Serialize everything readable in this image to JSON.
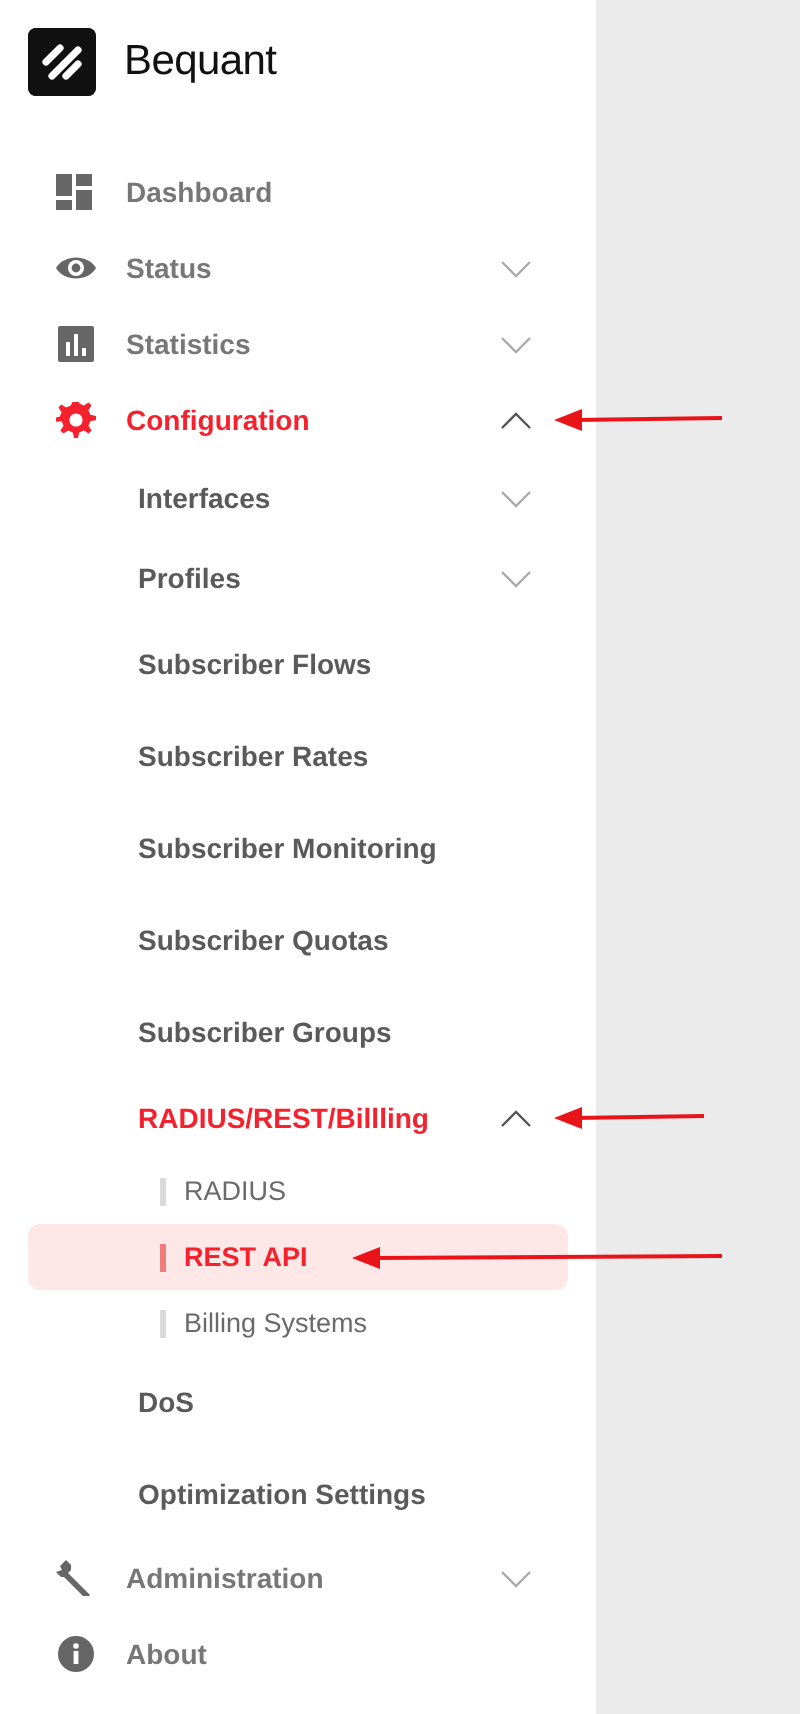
{
  "brand": {
    "name": "Bequant"
  },
  "nav": [
    {
      "label": "Dashboard",
      "selected": false,
      "arrow": false
    },
    {
      "label": "Status",
      "selected": false,
      "expanded": false,
      "arrow": false
    },
    {
      "label": "Statistics",
      "selected": false,
      "expanded": false,
      "arrow": false
    },
    {
      "label": "Configuration",
      "selected": false,
      "expanded": true,
      "arrow": true,
      "children": [
        {
          "label": "Interfaces",
          "selected": false,
          "expanded": false,
          "arrow": false
        },
        {
          "label": "Profiles",
          "selected": false,
          "expanded": false,
          "arrow": false
        },
        {
          "label": "Subscriber Flows",
          "selected": false,
          "arrow": false
        },
        {
          "label": "Subscriber Rates",
          "selected": false,
          "arrow": false
        },
        {
          "label": "Subscriber Monitoring",
          "selected": false,
          "arrow": false
        },
        {
          "label": "Subscriber Quotas",
          "selected": false,
          "arrow": false
        },
        {
          "label": "Subscriber Groups",
          "selected": false,
          "arrow": false
        },
        {
          "label": "RADIUS/REST/Billling",
          "selected": false,
          "expanded": true,
          "arrow": true,
          "children": [
            {
              "label": "RADIUS",
              "selected": false,
              "arrow": false
            },
            {
              "label": "REST API",
              "selected": true,
              "arrow": true
            },
            {
              "label": "Billing Systems",
              "selected": false,
              "arrow": false
            }
          ]
        },
        {
          "label": "DoS",
          "selected": false,
          "arrow": false
        },
        {
          "label": "Optimization Settings",
          "selected": false,
          "arrow": false
        }
      ]
    },
    {
      "label": "Administration",
      "selected": false,
      "expanded": false,
      "arrow": false
    },
    {
      "label": "About",
      "selected": false,
      "arrow": false
    }
  ]
}
